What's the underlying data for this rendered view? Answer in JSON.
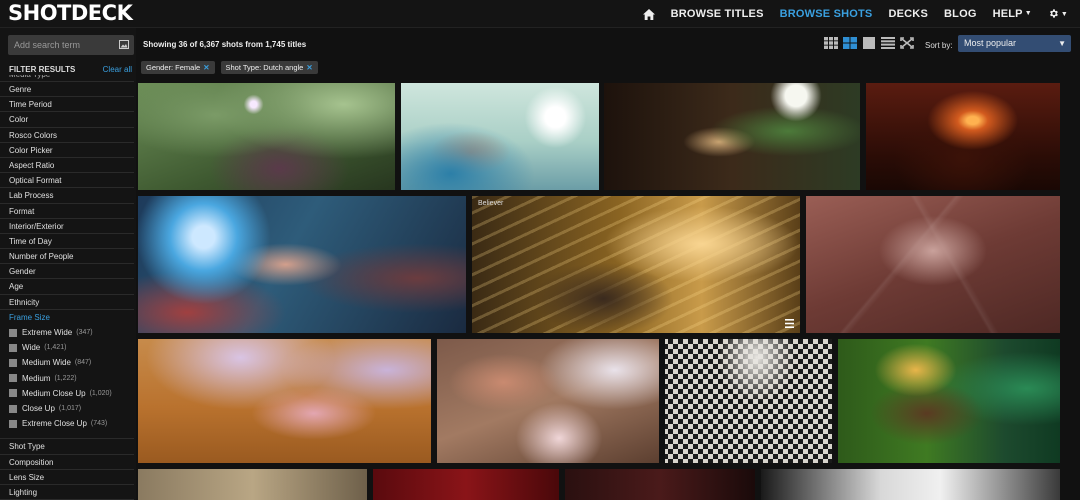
{
  "brand": {
    "name": "SHOTDECK"
  },
  "nav": {
    "items": [
      {
        "label": "BROWSE TITLES"
      },
      {
        "label": "BROWSE SHOTS",
        "active": true
      },
      {
        "label": "DECKS"
      },
      {
        "label": "BLOG"
      },
      {
        "label": "HELP"
      }
    ],
    "home_icon": "home-icon",
    "settings_icon": "gear-icon",
    "accent": "#3aa0e0"
  },
  "search": {
    "placeholder": "Add search term"
  },
  "filters": {
    "title": "FILTER RESULTS",
    "clear_label": "Clear all",
    "partial_top": "Media Type",
    "items": [
      "Genre",
      "Time Period",
      "Color",
      "Rosco Colors",
      "Color Picker",
      "Aspect Ratio",
      "Optical Format",
      "Lab Process",
      "Format",
      "Interior/Exterior",
      "Time of Day",
      "Number of People",
      "Gender",
      "Age",
      "Ethnicity"
    ],
    "active_item": "Frame Size",
    "frame_sizes": [
      {
        "label": "Extreme Wide",
        "count": "(347)"
      },
      {
        "label": "Wide",
        "count": "(1,421)"
      },
      {
        "label": "Medium Wide",
        "count": "(847)"
      },
      {
        "label": "Medium",
        "count": "(1,222)"
      },
      {
        "label": "Medium Close Up",
        "count": "(1,020)"
      },
      {
        "label": "Close Up",
        "count": "(1,017)"
      },
      {
        "label": "Extreme Close Up",
        "count": "(743)"
      }
    ],
    "after_items": [
      "Shot Type",
      "Composition",
      "Lens Size"
    ],
    "partial_bottom": "Lighting"
  },
  "results": {
    "showing": "Showing 36 of 6,367 shots from 1,745 titles",
    "sort_label": "Sort by:",
    "sort_value": "Most popular",
    "chips": [
      {
        "label": "Gender: Female"
      },
      {
        "label": "Shot Type: Dutch angle"
      }
    ],
    "tile_badge": "Believer"
  },
  "colors": {
    "selected_view": "#2f8fd4",
    "sort_bg": "#334d73"
  }
}
